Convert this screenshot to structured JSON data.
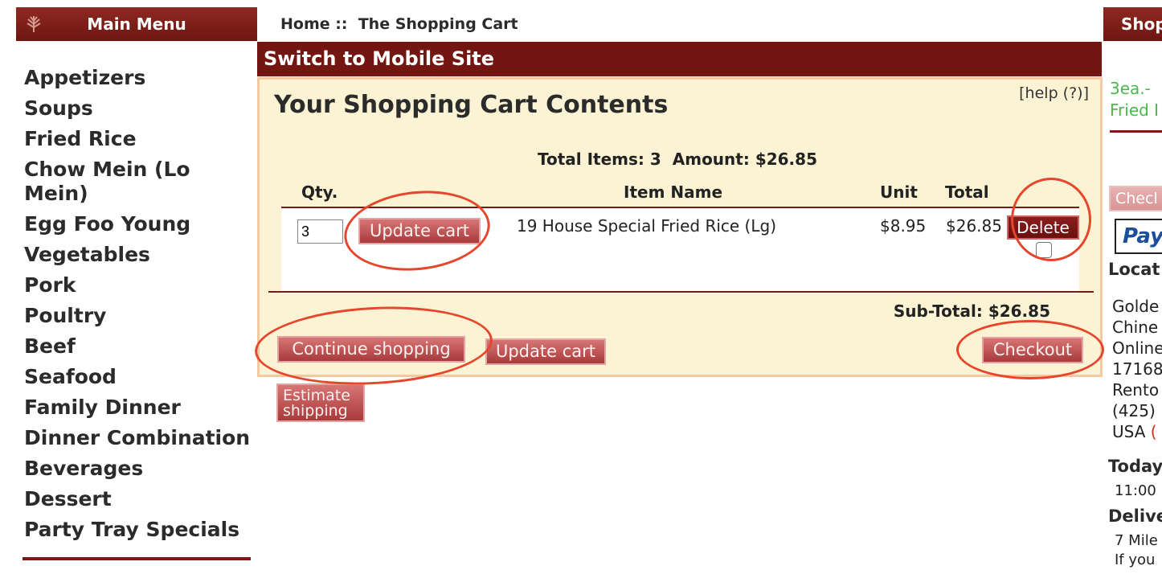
{
  "menu": {
    "title": "Main Menu",
    "items": [
      "Appetizers",
      "Soups",
      "Fried Rice",
      "Chow Mein (Lo Mein)",
      "Egg Foo Young",
      "Vegetables",
      "Pork",
      "Poultry",
      "Beef",
      "Seafood",
      "Family Dinner",
      "Dinner Combination",
      "Beverages",
      "Dessert",
      "Party Tray Specials"
    ]
  },
  "breadcrumb": {
    "home": "Home",
    "separator": "::",
    "current": "The Shopping Cart"
  },
  "mobile_link": "Switch to Mobile Site",
  "cart": {
    "help": "[help (?)]",
    "title": "Your Shopping Cart Contents",
    "total_items_label": "Total Items:",
    "total_items": "3",
    "amount_label": "Amount:",
    "amount": "$26.85",
    "headers": {
      "qty": "Qty.",
      "item": "Item Name",
      "unit": "Unit",
      "total": "Total"
    },
    "row": {
      "qty": "3",
      "update_label": "Update cart",
      "item": "19 House Special Fried Rice (Lg)",
      "unit": "$8.95",
      "total": "$26.85",
      "delete_label": "Delete"
    },
    "subtotal_label": "Sub-Total:",
    "subtotal": "$26.85",
    "continue_label": "Continue shopping",
    "update_label": "Update cart",
    "checkout_label": "Checkout",
    "estimate_label_1": "Estimate",
    "estimate_label_2": "shipping"
  },
  "right": {
    "header": "Shop",
    "green_1": "3ea.-",
    "green_2": "Fried I",
    "checkout_btn": "Checl",
    "paypal": "Pay",
    "location_heading": "Locat",
    "address": [
      "Golde",
      "Chine",
      "Online",
      "17168",
      "Rento",
      "(425)",
      "USA"
    ],
    "address_link": "(",
    "today_heading": "Today",
    "hours": "11:00",
    "delivery_heading": "Delive",
    "delivery_1": "7 Mile",
    "delivery_2": "If you"
  },
  "colors": {
    "maroon": "#731510",
    "cart_bg": "#fbf3d3",
    "button": "#b04848",
    "annotation": "#e6462b",
    "green": "#4bb84a"
  }
}
